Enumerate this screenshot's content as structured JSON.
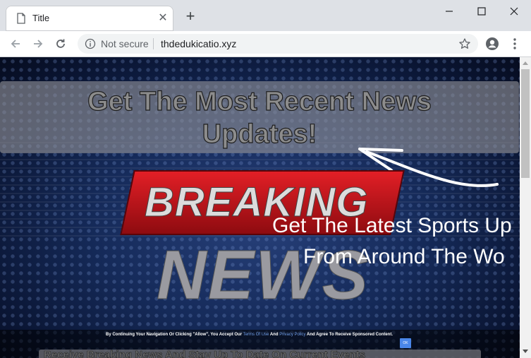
{
  "tab": {
    "title": "Title",
    "favicon": "document-icon",
    "close": "✕"
  },
  "new_tab": "+",
  "window": {
    "minimize": "minimize-icon",
    "maximize": "maximize-icon",
    "close": "close-icon"
  },
  "toolbar": {
    "security_label": "Not secure",
    "url": "thdedukicatio.xyz"
  },
  "page": {
    "headline_line1": "Get The Most Recent News",
    "headline_line2": "Updates!",
    "breaking": "BREAKING",
    "news": "NEWS",
    "sports_line1": "Get The Latest Sports Up",
    "sports_line2": "From Around The Wo",
    "consent_prefix": "By Continuing Your Navigation Or Clicking \"Allow\", You Accept Our",
    "consent_terms": "Terms Of Use",
    "consent_and": "And",
    "consent_privacy": "Privacy Policy",
    "consent_suffix": "And Agree To Receive Sponsored Content.",
    "ok_label": "OK",
    "bottom_text": "Receive Breaking News And Stay Up To Date On Current Events"
  },
  "colors": {
    "accent_red": "#e21f26",
    "page_bg": "#152a59",
    "link": "#6f9de8"
  }
}
